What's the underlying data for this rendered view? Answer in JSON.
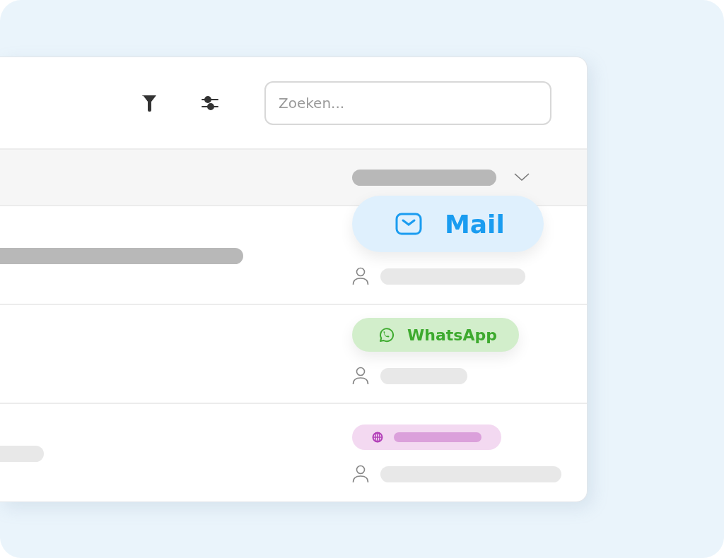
{
  "toolbar": {
    "search": {
      "placeholder": "Zoeken..."
    }
  },
  "rows": [
    {
      "channel": {
        "kind": "mail",
        "label": "Mail"
      }
    },
    {
      "channel": {
        "kind": "whatsapp",
        "label": "WhatsApp"
      }
    },
    {
      "channel": {
        "kind": "web"
      }
    }
  ]
}
